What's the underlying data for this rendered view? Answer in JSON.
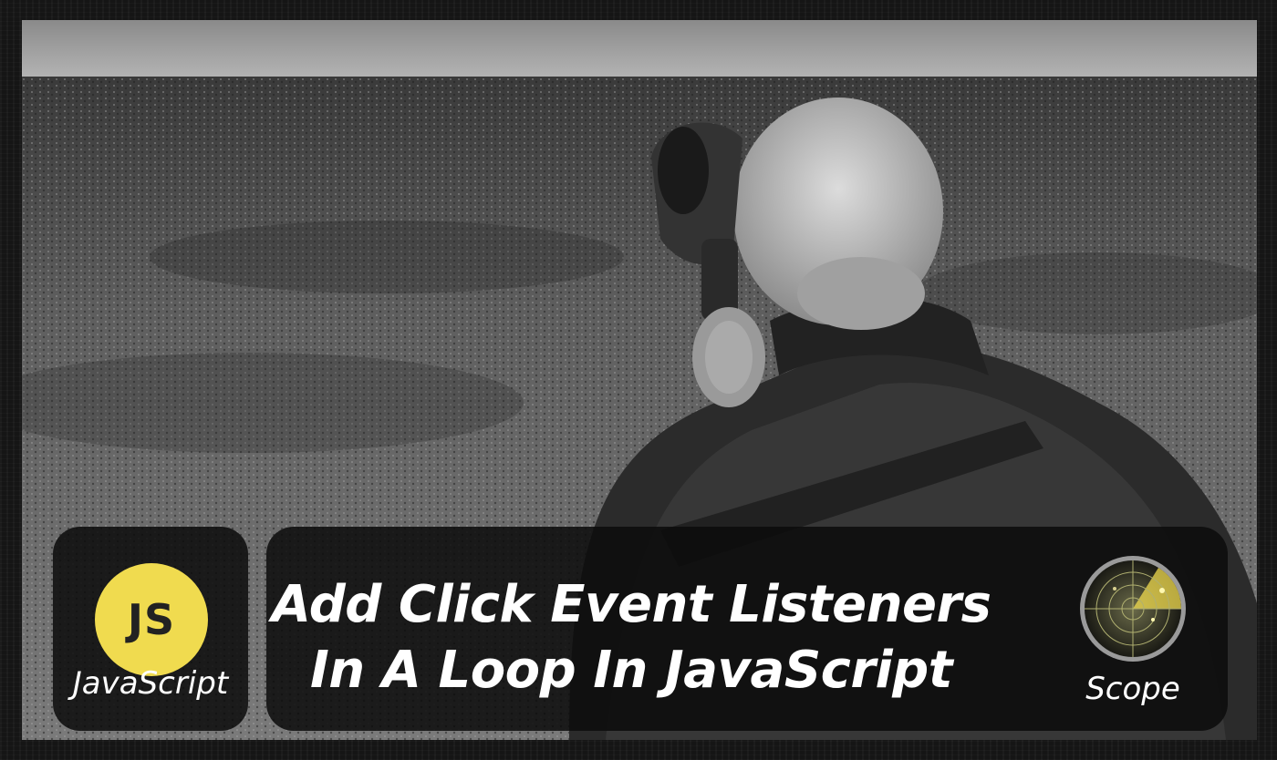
{
  "thumbnail": {
    "category_badge": {
      "icon_text": "JS",
      "label": "JavaScript",
      "color": "#f0db4f"
    },
    "title_lines": [
      "Add Click Event Listeners",
      "In A Loop In JavaScript"
    ],
    "topic_badge": {
      "icon": "radar-scope-icon",
      "label": "Scope"
    }
  }
}
